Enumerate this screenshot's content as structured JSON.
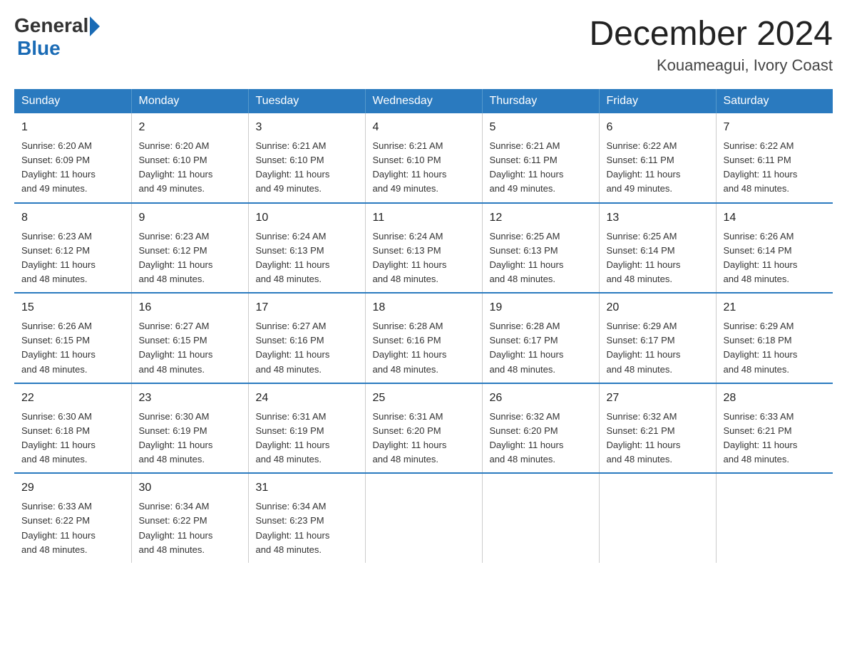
{
  "logo": {
    "general": "General",
    "blue": "Blue"
  },
  "title": "December 2024",
  "location": "Kouameagui, Ivory Coast",
  "days_of_week": [
    "Sunday",
    "Monday",
    "Tuesday",
    "Wednesday",
    "Thursday",
    "Friday",
    "Saturday"
  ],
  "weeks": [
    [
      {
        "day": "1",
        "sunrise": "6:20 AM",
        "sunset": "6:09 PM",
        "daylight": "11 hours and 49 minutes."
      },
      {
        "day": "2",
        "sunrise": "6:20 AM",
        "sunset": "6:10 PM",
        "daylight": "11 hours and 49 minutes."
      },
      {
        "day": "3",
        "sunrise": "6:21 AM",
        "sunset": "6:10 PM",
        "daylight": "11 hours and 49 minutes."
      },
      {
        "day": "4",
        "sunrise": "6:21 AM",
        "sunset": "6:10 PM",
        "daylight": "11 hours and 49 minutes."
      },
      {
        "day": "5",
        "sunrise": "6:21 AM",
        "sunset": "6:11 PM",
        "daylight": "11 hours and 49 minutes."
      },
      {
        "day": "6",
        "sunrise": "6:22 AM",
        "sunset": "6:11 PM",
        "daylight": "11 hours and 49 minutes."
      },
      {
        "day": "7",
        "sunrise": "6:22 AM",
        "sunset": "6:11 PM",
        "daylight": "11 hours and 48 minutes."
      }
    ],
    [
      {
        "day": "8",
        "sunrise": "6:23 AM",
        "sunset": "6:12 PM",
        "daylight": "11 hours and 48 minutes."
      },
      {
        "day": "9",
        "sunrise": "6:23 AM",
        "sunset": "6:12 PM",
        "daylight": "11 hours and 48 minutes."
      },
      {
        "day": "10",
        "sunrise": "6:24 AM",
        "sunset": "6:13 PM",
        "daylight": "11 hours and 48 minutes."
      },
      {
        "day": "11",
        "sunrise": "6:24 AM",
        "sunset": "6:13 PM",
        "daylight": "11 hours and 48 minutes."
      },
      {
        "day": "12",
        "sunrise": "6:25 AM",
        "sunset": "6:13 PM",
        "daylight": "11 hours and 48 minutes."
      },
      {
        "day": "13",
        "sunrise": "6:25 AM",
        "sunset": "6:14 PM",
        "daylight": "11 hours and 48 minutes."
      },
      {
        "day": "14",
        "sunrise": "6:26 AM",
        "sunset": "6:14 PM",
        "daylight": "11 hours and 48 minutes."
      }
    ],
    [
      {
        "day": "15",
        "sunrise": "6:26 AM",
        "sunset": "6:15 PM",
        "daylight": "11 hours and 48 minutes."
      },
      {
        "day": "16",
        "sunrise": "6:27 AM",
        "sunset": "6:15 PM",
        "daylight": "11 hours and 48 minutes."
      },
      {
        "day": "17",
        "sunrise": "6:27 AM",
        "sunset": "6:16 PM",
        "daylight": "11 hours and 48 minutes."
      },
      {
        "day": "18",
        "sunrise": "6:28 AM",
        "sunset": "6:16 PM",
        "daylight": "11 hours and 48 minutes."
      },
      {
        "day": "19",
        "sunrise": "6:28 AM",
        "sunset": "6:17 PM",
        "daylight": "11 hours and 48 minutes."
      },
      {
        "day": "20",
        "sunrise": "6:29 AM",
        "sunset": "6:17 PM",
        "daylight": "11 hours and 48 minutes."
      },
      {
        "day": "21",
        "sunrise": "6:29 AM",
        "sunset": "6:18 PM",
        "daylight": "11 hours and 48 minutes."
      }
    ],
    [
      {
        "day": "22",
        "sunrise": "6:30 AM",
        "sunset": "6:18 PM",
        "daylight": "11 hours and 48 minutes."
      },
      {
        "day": "23",
        "sunrise": "6:30 AM",
        "sunset": "6:19 PM",
        "daylight": "11 hours and 48 minutes."
      },
      {
        "day": "24",
        "sunrise": "6:31 AM",
        "sunset": "6:19 PM",
        "daylight": "11 hours and 48 minutes."
      },
      {
        "day": "25",
        "sunrise": "6:31 AM",
        "sunset": "6:20 PM",
        "daylight": "11 hours and 48 minutes."
      },
      {
        "day": "26",
        "sunrise": "6:32 AM",
        "sunset": "6:20 PM",
        "daylight": "11 hours and 48 minutes."
      },
      {
        "day": "27",
        "sunrise": "6:32 AM",
        "sunset": "6:21 PM",
        "daylight": "11 hours and 48 minutes."
      },
      {
        "day": "28",
        "sunrise": "6:33 AM",
        "sunset": "6:21 PM",
        "daylight": "11 hours and 48 minutes."
      }
    ],
    [
      {
        "day": "29",
        "sunrise": "6:33 AM",
        "sunset": "6:22 PM",
        "daylight": "11 hours and 48 minutes."
      },
      {
        "day": "30",
        "sunrise": "6:34 AM",
        "sunset": "6:22 PM",
        "daylight": "11 hours and 48 minutes."
      },
      {
        "day": "31",
        "sunrise": "6:34 AM",
        "sunset": "6:23 PM",
        "daylight": "11 hours and 48 minutes."
      },
      null,
      null,
      null,
      null
    ]
  ],
  "labels": {
    "sunrise": "Sunrise:",
    "sunset": "Sunset:",
    "daylight": "Daylight:"
  }
}
